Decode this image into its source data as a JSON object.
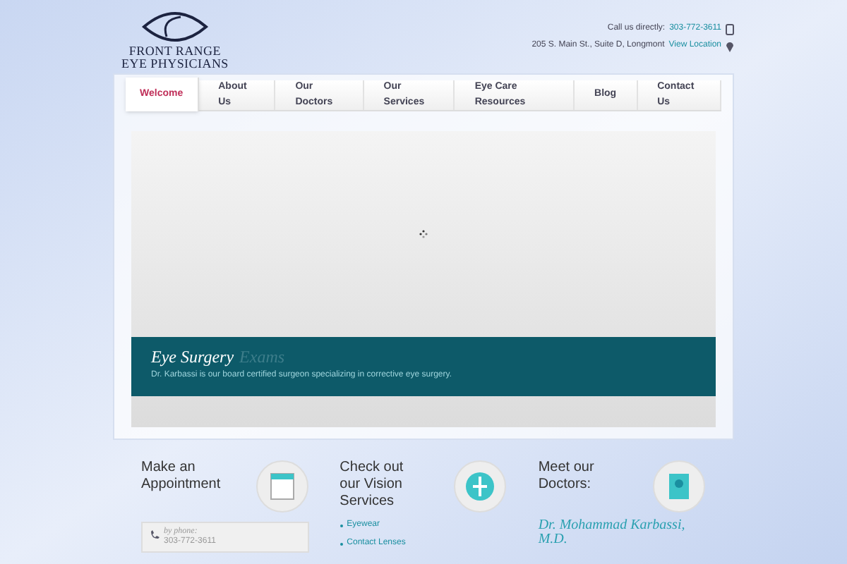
{
  "logo": {
    "line1": "FRONT RANGE",
    "line2": "EYE PHYSICIANS"
  },
  "contact": {
    "call_label": "Call us directly:",
    "phone": "303-772-3611",
    "address": "205 S. Main St., Suite D, Longmont",
    "location_link": "View Location"
  },
  "nav": [
    {
      "label": "Welcome",
      "selected": true
    },
    {
      "label": "About Us",
      "selected": false
    },
    {
      "label": "Our Doctors",
      "selected": false
    },
    {
      "label": "Our Services",
      "selected": false
    },
    {
      "label": "Eye Care Resources",
      "selected": false
    },
    {
      "label": "Blog",
      "selected": false
    },
    {
      "label": "Contact Us",
      "selected": false
    }
  ],
  "slider": {
    "title": "Eye Surgery",
    "faded_title": "Exams",
    "caption": "Dr. Karbassi is our board certified surgeon specializing in corrective eye surgery."
  },
  "columns": [
    {
      "kind": "appointment",
      "title": "Make an Appointment",
      "phone_label": "by phone:",
      "phone": "303-772-3611"
    },
    {
      "kind": "services",
      "title": "Check out our Vision Services",
      "items": [
        "Eyewear",
        "Contact Lenses"
      ]
    },
    {
      "kind": "doctors",
      "title": "Meet our Doctors:",
      "doctor": "Dr. Mohammad Karbassi, M.D."
    }
  ]
}
